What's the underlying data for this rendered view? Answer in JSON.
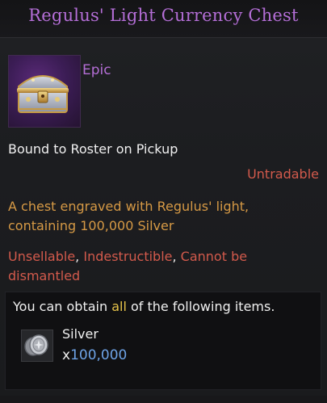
{
  "item": {
    "name": "Regulus' Light Currency Chest",
    "grade": "Epic",
    "icon": "treasure-chest-icon",
    "bound": "Bound to Roster on Pickup",
    "trade_status": "Untradable",
    "description_line1": "A chest engraved with Regulus' light,",
    "description_line2": "containing 100,000 Silver",
    "restrictions": {
      "r1": "Unsellable",
      "sep1": ", ",
      "r2": "Indestructible",
      "sep2": ", ",
      "r3": "Cannot be",
      "r3b": "dismantled"
    }
  },
  "obtain": {
    "prefix": "You can obtain ",
    "highlight": "all",
    "suffix": " of the following items.",
    "items": [
      {
        "name": "Silver",
        "qty_prefix": "x",
        "qty": "100,000",
        "icon": "silver-coins-icon"
      }
    ]
  },
  "colors": {
    "epic": "#b46ed6",
    "warning": "#d35a4c",
    "description": "#d69945",
    "highlight": "#e6c34a",
    "quantity": "#6ea3e6"
  }
}
